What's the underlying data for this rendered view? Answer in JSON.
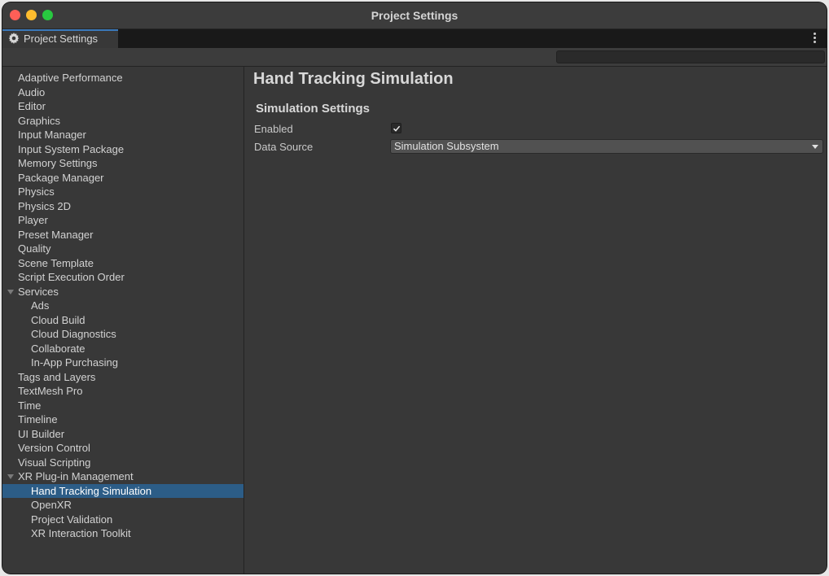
{
  "window": {
    "title": "Project Settings"
  },
  "tab": {
    "label": "Project Settings"
  },
  "search": {
    "value": ""
  },
  "sidebar": {
    "items": [
      {
        "label": "Adaptive Performance",
        "level": 0
      },
      {
        "label": "Audio",
        "level": 0
      },
      {
        "label": "Editor",
        "level": 0
      },
      {
        "label": "Graphics",
        "level": 0
      },
      {
        "label": "Input Manager",
        "level": 0
      },
      {
        "label": "Input System Package",
        "level": 0
      },
      {
        "label": "Memory Settings",
        "level": 0
      },
      {
        "label": "Package Manager",
        "level": 0
      },
      {
        "label": "Physics",
        "level": 0
      },
      {
        "label": "Physics 2D",
        "level": 0
      },
      {
        "label": "Player",
        "level": 0
      },
      {
        "label": "Preset Manager",
        "level": 0
      },
      {
        "label": "Quality",
        "level": 0
      },
      {
        "label": "Scene Template",
        "level": 0
      },
      {
        "label": "Script Execution Order",
        "level": 0
      },
      {
        "label": "Services",
        "level": 0,
        "expanded": true
      },
      {
        "label": "Ads",
        "level": 1
      },
      {
        "label": "Cloud Build",
        "level": 1
      },
      {
        "label": "Cloud Diagnostics",
        "level": 1
      },
      {
        "label": "Collaborate",
        "level": 1
      },
      {
        "label": "In-App Purchasing",
        "level": 1
      },
      {
        "label": "Tags and Layers",
        "level": 0
      },
      {
        "label": "TextMesh Pro",
        "level": 0
      },
      {
        "label": "Time",
        "level": 0
      },
      {
        "label": "Timeline",
        "level": 0
      },
      {
        "label": "UI Builder",
        "level": 0
      },
      {
        "label": "Version Control",
        "level": 0
      },
      {
        "label": "Visual Scripting",
        "level": 0
      },
      {
        "label": "XR Plug-in Management",
        "level": 0,
        "expanded": true
      },
      {
        "label": "Hand Tracking Simulation",
        "level": 1,
        "selected": true
      },
      {
        "label": "OpenXR",
        "level": 1
      },
      {
        "label": "Project Validation",
        "level": 1
      },
      {
        "label": "XR Interaction Toolkit",
        "level": 1
      }
    ]
  },
  "content": {
    "title": "Hand Tracking Simulation",
    "section_title": "Simulation Settings",
    "enabled_label": "Enabled",
    "enabled_checked": true,
    "data_source_label": "Data Source",
    "data_source_value": "Simulation Subsystem"
  },
  "colors": {
    "selection": "#2c5d87",
    "tab_accent": "#3a79bb",
    "close": "#fe5f57",
    "minimize": "#febc2e",
    "maximize": "#28c840"
  }
}
